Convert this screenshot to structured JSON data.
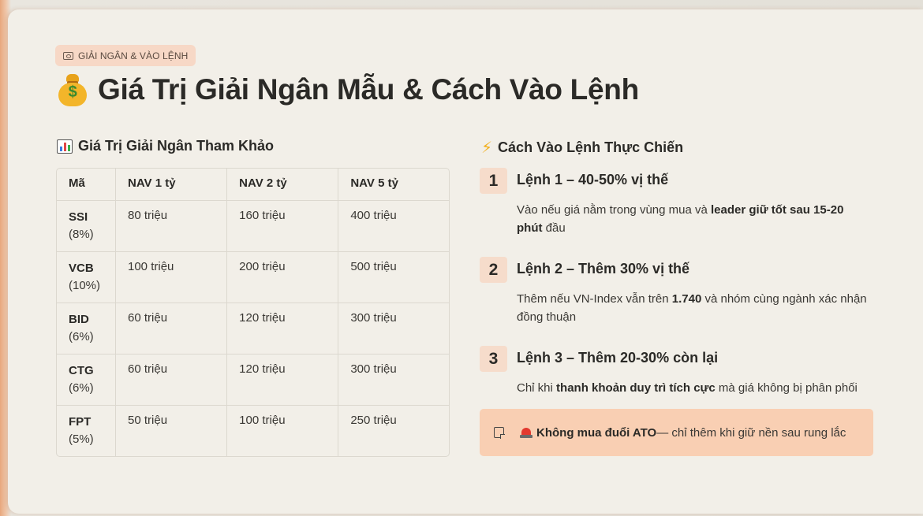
{
  "tag": "GIẢI NGÂN & VÀO LỆNH",
  "title": "Giá Trị Giải Ngân Mẫu & Cách Vào Lệnh",
  "left": {
    "heading": "Giá Trị Giải Ngân Tham Khảo",
    "columns": [
      "Mã",
      "NAV 1 tỷ",
      "NAV 2 tỷ",
      "NAV 5 tỷ"
    ],
    "rows": [
      {
        "code": "SSI",
        "pct": "(8%)",
        "v1": "80 triệu",
        "v2": "160 triệu",
        "v5": "400 triệu"
      },
      {
        "code": "VCB",
        "pct": "(10%)",
        "v1": "100 triệu",
        "v2": "200 triệu",
        "v5": "500 triệu"
      },
      {
        "code": "BID",
        "pct": "(6%)",
        "v1": "60 triệu",
        "v2": "120 triệu",
        "v5": "300 triệu"
      },
      {
        "code": "CTG",
        "pct": "(6%)",
        "v1": "60 triệu",
        "v2": "120 triệu",
        "v5": "300 triệu"
      },
      {
        "code": "FPT",
        "pct": "(5%)",
        "v1": "50 triệu",
        "v2": "100 triệu",
        "v5": "250 triệu"
      }
    ]
  },
  "right": {
    "heading": "Cách Vào Lệnh Thực Chiến",
    "steps": [
      {
        "num": "1",
        "title": "Lệnh 1 – 40-50% vị thế",
        "desc_a": "Vào nếu giá nằm trong vùng mua và ",
        "desc_b": "leader giữ tốt sau 15-20 phút",
        "desc_c": " đầu"
      },
      {
        "num": "2",
        "title": "Lệnh 2 – Thêm 30% vị thế",
        "desc_a": "Thêm nếu VN-Index vẫn trên ",
        "desc_b": "1.740",
        "desc_c": " và nhóm cùng ngành xác nhận đồng thuận"
      },
      {
        "num": "3",
        "title": "Lệnh 3 – Thêm 20-30% còn lại",
        "desc_a": "Chỉ khi ",
        "desc_b": "thanh khoản duy trì tích cực",
        "desc_c": " mà giá không bị phân phối"
      }
    ],
    "alert": {
      "bold": "Không mua đuổi ATO",
      "text": " — chỉ thêm khi giữ nền sau rung lắc"
    }
  },
  "icons": {
    "tag": "money-icon",
    "title": "money-bag-icon",
    "left_heading": "bar-chart-icon",
    "right_heading": "lightning-icon",
    "alert_note": "note-icon",
    "alert_siren": "siren-icon"
  }
}
